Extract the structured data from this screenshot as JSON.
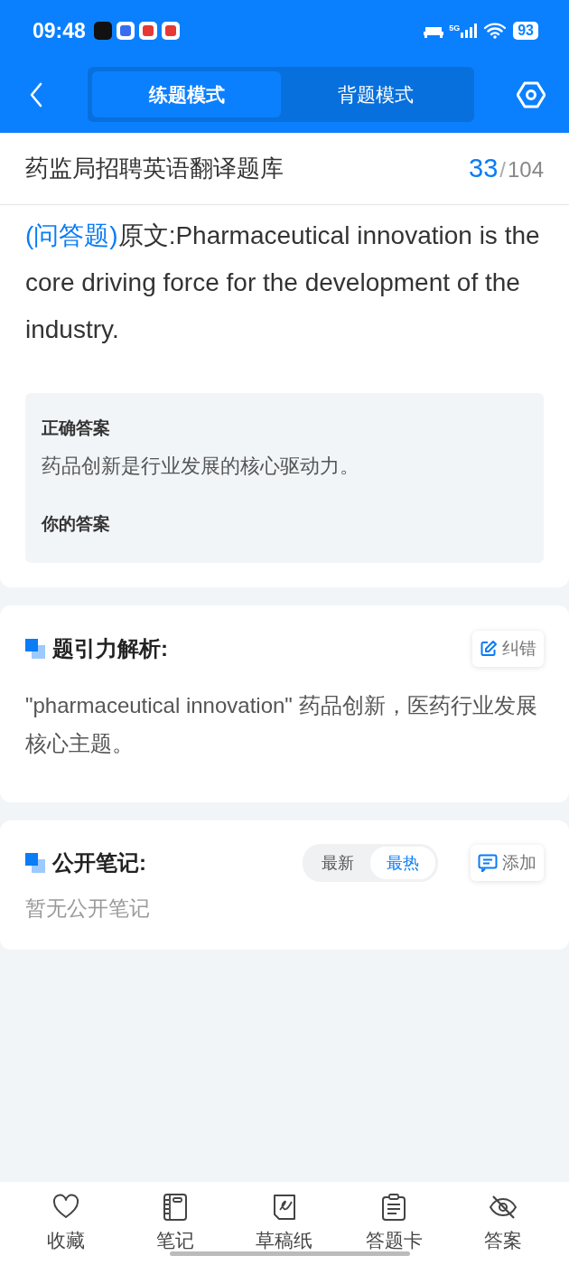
{
  "status_bar": {
    "time": "09:48",
    "network": "5G",
    "battery": "93"
  },
  "header": {
    "tabs": [
      {
        "label": "练题模式",
        "selected": true
      },
      {
        "label": "背题模式",
        "selected": false
      }
    ]
  },
  "title_bar": {
    "title": "药监局招聘英语翻译题库",
    "current": "33",
    "separator": "/",
    "total": "104"
  },
  "question": {
    "type_tag": "(问答题)",
    "text": "原文:Pharmaceutical innovation is the core driving force for the development of the industry."
  },
  "answer_box": {
    "correct_label": "正确答案",
    "correct_answer": "药品创新是行业发展的核心驱动力。",
    "your_label": "你的答案"
  },
  "analysis": {
    "title": "题引力解析:",
    "button": "纠错",
    "text": "\"pharmaceutical innovation\" 药品创新，医药行业发展核心主题。"
  },
  "notes": {
    "title": "公开笔记:",
    "sort_options": [
      {
        "label": "最新",
        "selected": false
      },
      {
        "label": "最热",
        "selected": true
      }
    ],
    "button": "添加",
    "empty_text": "暂无公开笔记"
  },
  "bottom_nav": [
    {
      "kind": "heart",
      "label": "收藏"
    },
    {
      "kind": "notebook",
      "label": "笔记"
    },
    {
      "kind": "draft",
      "label": "草稿纸"
    },
    {
      "kind": "clipboard",
      "label": "答题卡"
    },
    {
      "kind": "eye-off",
      "label": "答案"
    }
  ]
}
